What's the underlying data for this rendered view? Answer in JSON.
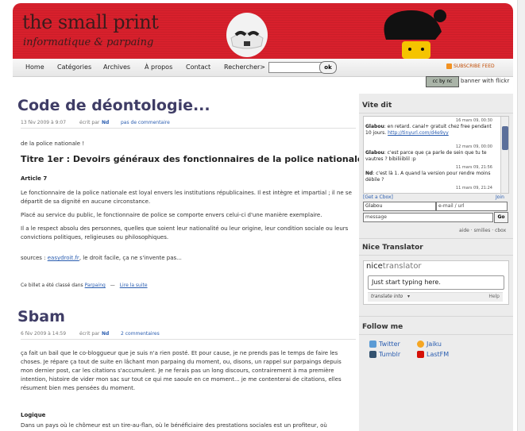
{
  "header": {
    "title": "the small print",
    "tagline": "informatique & parpaing"
  },
  "nav": {
    "items": [
      "Home",
      "Catégories",
      "Archives",
      "À propos",
      "Contact",
      "Rechercher>"
    ],
    "search_value": "",
    "ok_label": "ok",
    "feed_label": "SUBSCRIBE FEED"
  },
  "cc": {
    "badge": "cc by nc",
    "text": "banner with flickr"
  },
  "posts": [
    {
      "title": "Code de déontologie...",
      "date": "13 fév 2009 à 9:07",
      "author_prefix": "écrit par",
      "author": "Nd",
      "comments": "pas de commentaire",
      "intro": "de la police nationale !",
      "subtitle": "Titre 1er : Devoirs généraux des fonctionnaires de la police nationale",
      "article": "Article 7",
      "paragraphs": [
        "Le fonctionnaire de la police nationale est loyal envers les institutions républicaines. Il est intègre et impartial ; il ne se départit de sa dignité en aucune circonstance.",
        "Placé au service du public, le fonctionnaire de police se comporte envers celui-ci d'une manière exemplaire.",
        "Il a le respect absolu des personnes, quelles que soient leur nationalité ou leur origine, leur condition sociale ou leurs convictions politiques, religieuses ou philosophiques."
      ],
      "sources_prefix": "sources :",
      "sources_link": "easydroit.fr",
      "sources_suffix": ", le droit facile, ça ne s'invente pas...",
      "classed_prefix": "Ce billet a été classé dans",
      "category": "Parpaing",
      "read_more": "Lire la suite"
    },
    {
      "title": "Sbam",
      "date": "6 fév 2009 à 14:59",
      "author_prefix": "écrit par",
      "author": "Nd",
      "comments": "2 commentaires",
      "paragraphs": [
        "ça fait un bail que le co-bloggueur que je suis n'a rien posté. Et pour cause, je ne prends pas le temps de faire les choses. Je répare ça tout de suite en lâchant mon parpaing du moment, ou, disons, un rappel sur parpaings depuis mon dernier post, car les citations s'accumulent. Je ne ferais pas un long discours, contrairement à ma première intention, histoire de vider mon sac sur tout ce qui me saoule en ce moment... je me contenterai de citations, elles résument bien mes pensées du moment."
      ],
      "subheading": "Logique",
      "last_line": "Dans un pays où le chômeur est un tire-au-flan, où le bénéficiaire des prestations sociales est un profiteur, où"
    }
  ],
  "sidebar": {
    "vite_dit": {
      "title": "Vite dit",
      "entries": [
        {
          "time": "16 mars 09, 00:30",
          "author": "Glabou",
          "text": "en retard. canal+ gratuit chez free pendant 10 jours.",
          "link": "http://tinyurl.com/d4e9yy"
        },
        {
          "time": "12 mars 09, 00:00",
          "author": "Glabou",
          "text": "c'est parce que ça parle de sein que tu te vautres ? bibiliiiblil :p",
          "link": ""
        },
        {
          "time": "11 mars 09, 21:56",
          "author": "Nd",
          "text": "c'est là 1. A quand la version pour rendre moins débile ?",
          "link": ""
        },
        {
          "time": "11 mars 09, 21:24",
          "author": "",
          "text": "",
          "link": ""
        }
      ],
      "get_cbox": "[Get a Cbox]",
      "join": "Join",
      "name_value": "Glabou",
      "email_placeholder": "e-mail / url",
      "message_placeholder": "message",
      "go_label": "Go",
      "footer_links": "aide · smilies · cbox"
    },
    "translator": {
      "title": "Nice Translator",
      "logo_a": "nice",
      "logo_b": "translator",
      "input_placeholder": "Just start typing here.",
      "translate_into": "translate into",
      "help": "Help"
    },
    "follow": {
      "title": "Follow me",
      "items": [
        {
          "label": "Twitter",
          "color": "#5a9bd5"
        },
        {
          "label": "Jaiku",
          "color": "#f5a623"
        },
        {
          "label": "Tumblr",
          "color": "#34526f"
        },
        {
          "label": "LastFM",
          "color": "#d51007"
        }
      ]
    }
  }
}
